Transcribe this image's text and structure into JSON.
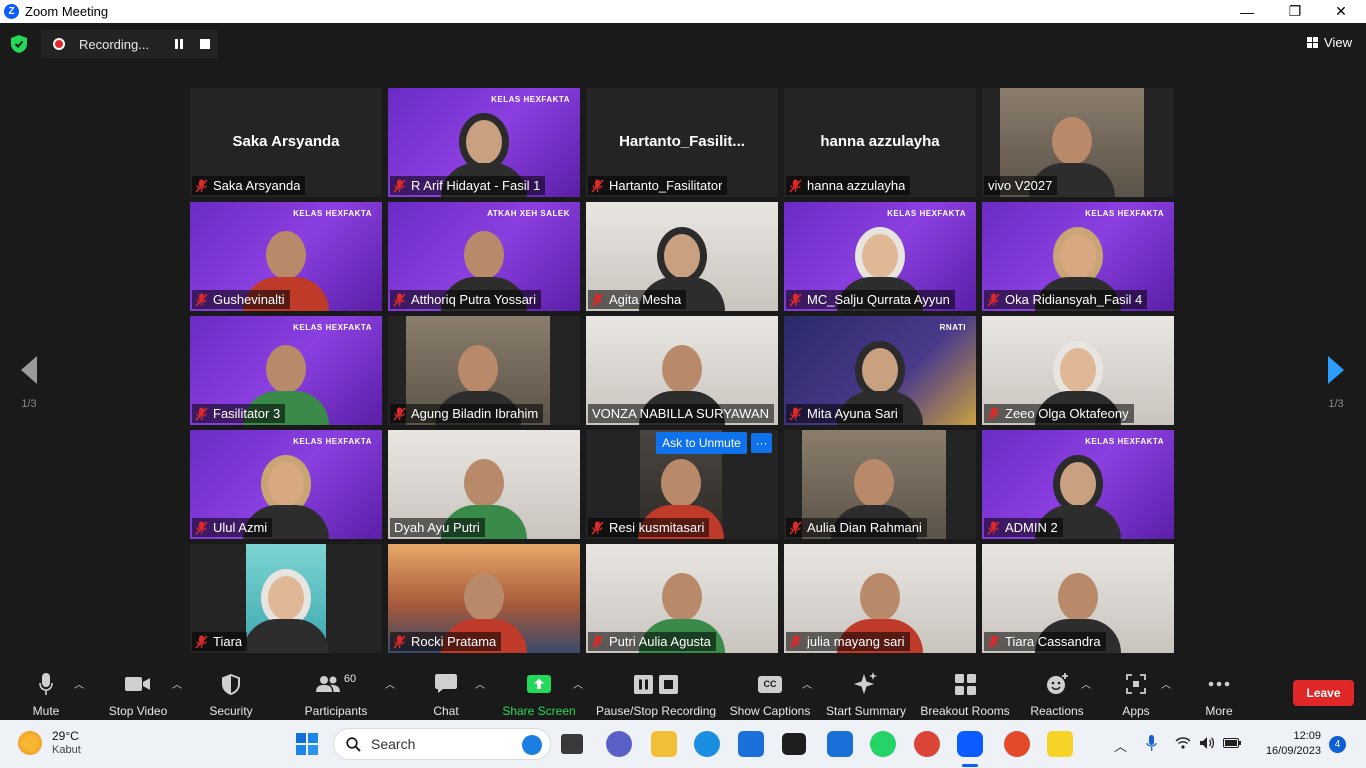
{
  "window": {
    "title": "Zoom Meeting",
    "minimize": "—",
    "maximize": "❐",
    "close": "✕"
  },
  "topbar": {
    "recording_label": "Recording...",
    "view_label": "View"
  },
  "page_indicator": {
    "left": "1/3",
    "right": "1/3"
  },
  "tiles": [
    {
      "name": "Saka Arsyanda",
      "muted": true,
      "video": "none",
      "big_name": "Saka Arsyanda"
    },
    {
      "name": "R Arif Hidayat - Fasil 1",
      "muted": true,
      "video": "purple",
      "active": true,
      "brand": "KELAS HEXFAKTA"
    },
    {
      "name": "Hartanto_Fasilitator",
      "muted": true,
      "video": "none",
      "big_name": "Hartanto_Fasilit..."
    },
    {
      "name": "hanna azzulayha",
      "muted": true,
      "video": "none",
      "big_name": "hanna azzulayha"
    },
    {
      "name": "vivo V2027",
      "muted": false,
      "video": "room"
    },
    {
      "name": "Gushevinalti",
      "muted": true,
      "video": "purple",
      "brand": "KELAS HEXFAKTA"
    },
    {
      "name": "Atthoriq Putra Yossari",
      "muted": true,
      "video": "purple",
      "brand": "ATKAH XEH SALEK"
    },
    {
      "name": "Agita Mesha",
      "muted": true,
      "video": "light"
    },
    {
      "name": "MC_Salju Qurrata Ayyun",
      "muted": true,
      "video": "purple",
      "brand": "KELAS HEXFAKTA"
    },
    {
      "name": "Oka Ridiansyah_Fasil 4",
      "muted": true,
      "video": "purple",
      "brand": "KELAS HEXFAKTA"
    },
    {
      "name": "Fasilitator 3",
      "muted": true,
      "video": "purple",
      "brand": "KELAS HEXFAKTA"
    },
    {
      "name": "Agung Biladin Ibrahim",
      "muted": true,
      "video": "room"
    },
    {
      "name": "VONZA NABILLA SURYAWAN",
      "muted": false,
      "video": "light"
    },
    {
      "name": "Mita Ayuna Sari",
      "muted": true,
      "video": "poster",
      "brand": "RNATI"
    },
    {
      "name": "Zeeo Olga Oktafeony",
      "muted": true,
      "video": "light"
    },
    {
      "name": "Ulul Azmi",
      "muted": true,
      "video": "purple",
      "brand": "KELAS HEXFAKTA"
    },
    {
      "name": "Dyah Ayu Putri",
      "muted": false,
      "video": "light"
    },
    {
      "name": "Resi kusmitasari",
      "muted": true,
      "video": "dim",
      "ask_unmute": "Ask to Unmute",
      "more": "···"
    },
    {
      "name": "Aulia Dian Rahmani",
      "muted": true,
      "video": "room"
    },
    {
      "name": "ADMIN 2",
      "muted": true,
      "video": "purple",
      "brand": "KELAS HEXFAKTA"
    },
    {
      "name": "Tiara",
      "muted": true,
      "video": "teal"
    },
    {
      "name": "Rocki Pratama",
      "muted": true,
      "video": "sunset"
    },
    {
      "name": "Putri Aulia Agusta",
      "muted": true,
      "video": "light"
    },
    {
      "name": "julia mayang sari",
      "muted": true,
      "video": "light"
    },
    {
      "name": "Tiara Cassandra",
      "muted": true,
      "video": "light"
    }
  ],
  "toolbar": {
    "mute": "Mute",
    "stop_video": "Stop Video",
    "security": "Security",
    "participants": "Participants",
    "participants_count": "60",
    "chat": "Chat",
    "share_screen": "Share Screen",
    "pause_stop_recording": "Pause/Stop Recording",
    "show_captions": "Show Captions",
    "start_summary": "Start Summary",
    "breakout_rooms": "Breakout Rooms",
    "reactions": "Reactions",
    "apps": "Apps",
    "more": "More",
    "leave": "Leave",
    "cc_icon_text": "CC"
  },
  "taskbar": {
    "temperature": "29°C",
    "condition": "Kabut",
    "search_placeholder": "Search",
    "time": "12:09",
    "date": "16/09/2023",
    "notifications": "4"
  },
  "colors": {
    "accent_blue": "#0e72ed",
    "leave_red": "#e02828",
    "share_green": "#23d959",
    "active_speaker": "#dce840",
    "purple_bg": "#7a35d2"
  }
}
